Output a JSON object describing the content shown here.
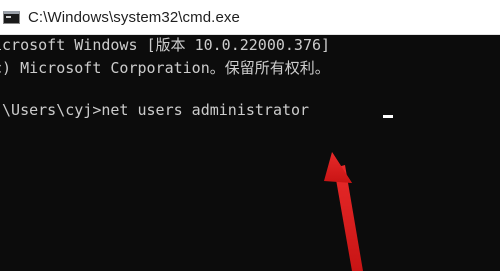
{
  "window": {
    "title": "C:\\Windows\\system32\\cmd.exe",
    "icon": "cmd-icon"
  },
  "console": {
    "lines": [
      "icrosoft Windows [版本 10.0.22000.376]",
      "c) Microsoft Corporation。保留所有权利。",
      ":\\Users\\cyj>net users administrator"
    ]
  },
  "annotation": {
    "arrow_color": "#e02020"
  }
}
